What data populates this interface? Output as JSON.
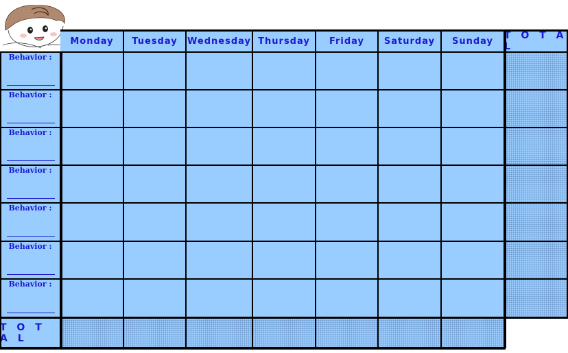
{
  "chart": {
    "days": [
      "Monday",
      "Tuesday",
      "Wednesday",
      "Thursday",
      "Friday",
      "Saturday",
      "Sunday"
    ],
    "total_label": "T O T A L",
    "row_total_label": "T O T A L",
    "behavior_label": "Behavior :",
    "behavior_rows": 7
  },
  "colors": {
    "cell": "#99ccff",
    "text": "#1a1ad0",
    "border": "#000000"
  }
}
